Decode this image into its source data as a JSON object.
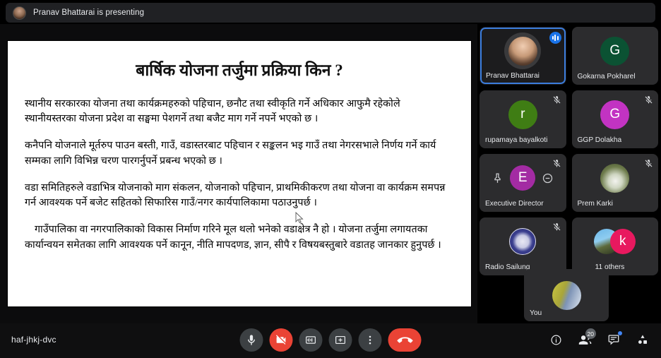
{
  "banner": {
    "text": "Pranav Bhattarai is presenting",
    "avatar_name": "presenter-avatar"
  },
  "slide": {
    "title": "बार्षिक योजना तर्जुमा प्रक्रिया किन ?",
    "paragraphs": [
      "स्थानीय सरकारका योजना तथा कार्यक्रमहरुको पहिचान, छनौट तथा स्वीकृति गर्ने अधिकार आफुमै रहेकोले स्थानीयस्तरका योजना प्रदेश वा सङ्घमा पेशगर्ने तथा बजैट माग गर्ने नपर्ने भएको छ ।",
      "कनैपनि योजनाले मूर्तरुप पाउन बस्ती, गाउँ, वडास्तरबाट पहिचान र सङ्कलन भइ गाउँ तथा नेगरसभाले निर्णय गर्ने कार्य सम्मका लागि विभिन्न चरण पारगर्नुपर्ने प्रबन्ध भएको छ ।",
      "वडा समितिहरुले वडाभित्र योजनाको माग संकलन, योजनाको पहिचान, प्राथमिकीकरण तथा योजना वा कार्यक्रम समपन्न गर्न आवश्यक पर्ने बजेट सहितको सिफारिस गाउँ/नगर कार्यपालिकामा पठाउनुपर्छ ।",
      "गाउँपालिका वा नगरपालिकाको विकास निर्माण गरिने मूल थलो भनेको वडाक्षेत्र नै हो । योजना तर्जुमा लगायतका कार्यान्वयन समेतका लागि आवश्यक पर्ने कानून, नीति मापदणड, ज्ञान, सीपै र विषयबस्तुबारे वडातह जानकार हुनुपर्छ ।"
    ]
  },
  "participants": [
    {
      "name": "Pranav Bhattarai",
      "kind": "photo",
      "active": true,
      "muted": false,
      "speaking": true
    },
    {
      "name": "Gokarna Pokharel",
      "kind": "initial",
      "initial": "G",
      "color": "#0b5233",
      "active": false,
      "muted": false
    },
    {
      "name": "rupamaya bayalkoti",
      "kind": "initial",
      "initial": "r",
      "color": "#3f7d14",
      "active": false,
      "muted": true
    },
    {
      "name": "GGP Dolakha",
      "kind": "initial",
      "initial": "G",
      "color": "#c233c2",
      "active": false,
      "muted": true
    },
    {
      "name": "Executive Director",
      "kind": "initial",
      "initial": "E",
      "color": "#a32ba3",
      "active": false,
      "muted": true,
      "hovered": true
    },
    {
      "name": "Prem Karki",
      "kind": "photo",
      "active": false,
      "muted": true
    },
    {
      "name": "Radio Sailung",
      "kind": "logo",
      "active": false,
      "muted": true
    },
    {
      "name": "11 others",
      "kind": "stack",
      "active": false,
      "muted": false,
      "stack_initial": "k",
      "stack_color": "#e8195f"
    }
  ],
  "self_tile": {
    "label": "You"
  },
  "bottom_bar": {
    "meeting_code": "haf-jhkj-dvc",
    "controls": [
      {
        "name": "microphone-button",
        "icon": "mic-icon",
        "state": "on"
      },
      {
        "name": "camera-button",
        "icon": "camera-off-icon",
        "state": "off"
      },
      {
        "name": "captions-button",
        "icon": "cc-icon",
        "state": "off"
      },
      {
        "name": "present-button",
        "icon": "present-screen-icon",
        "state": "off"
      },
      {
        "name": "more-options-button",
        "icon": "more-vert-icon",
        "state": "off"
      },
      {
        "name": "end-call-button",
        "icon": "end-call-icon",
        "state": "danger"
      }
    ],
    "right_icons": [
      {
        "name": "meeting-details-button",
        "icon": "info-icon",
        "badge": ""
      },
      {
        "name": "participants-button",
        "icon": "people-icon",
        "badge": "20"
      },
      {
        "name": "chat-button",
        "icon": "chat-icon",
        "badge": "",
        "dot": true
      },
      {
        "name": "activities-button",
        "icon": "activities-icon",
        "badge": ""
      }
    ]
  },
  "colors": {
    "accent_blue": "#1a73e8",
    "danger_red": "#ea4335",
    "tile_bg": "#2c2c2e",
    "bar_bg": "#202124"
  }
}
